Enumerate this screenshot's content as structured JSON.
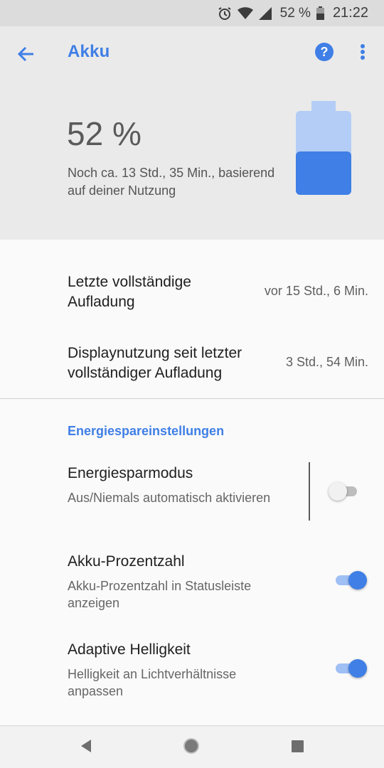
{
  "status_bar": {
    "battery_percent": "52 %",
    "time": "21:22",
    "icons": [
      "alarm-icon",
      "wifi-icon",
      "cell-signal-icon",
      "battery-icon"
    ]
  },
  "app_bar": {
    "title": "Akku",
    "help_icon_text": "?"
  },
  "battery": {
    "percent": "52 %",
    "remaining_text": "Noch ca. 13 Std., 35 Min., basierend auf deiner Nutzung",
    "level": 0.52,
    "colors": {
      "fill": "#3f7fe6",
      "empty": "#b3cdf6"
    }
  },
  "usage": [
    {
      "label": "Letzte vollständige Aufladung",
      "value": "vor 15 Std., 6 Min."
    },
    {
      "label": "Displaynutzung seit letzter vollständiger Aufladung",
      "value": "3 Std., 54 Min."
    }
  ],
  "section_title": "Energiespareinstellungen",
  "settings": [
    {
      "title": "Energiesparmodus",
      "subtitle": "Aus/Niemals automatisch aktivieren",
      "enabled": false
    },
    {
      "title": "Akku-Prozentzahl",
      "subtitle": "Akku-Prozentzahl in Statusleiste anzeigen",
      "enabled": true
    },
    {
      "title": "Adaptive Helligkeit",
      "subtitle": "Helligkeit an Lichtverhältnisse anpassen",
      "enabled": true
    }
  ],
  "colors": {
    "accent": "#3f7fe6"
  },
  "nav_bar": {
    "buttons": [
      "back-triangle-icon",
      "home-circle-icon",
      "recents-square-icon"
    ]
  }
}
